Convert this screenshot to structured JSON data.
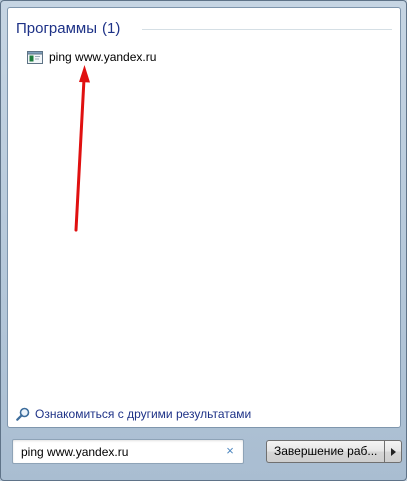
{
  "results_group": {
    "title": "Программы",
    "count": "(1)"
  },
  "results": [
    {
      "label": "ping www.yandex.ru",
      "icon": "command-prompt-icon"
    }
  ],
  "more_results": {
    "label": "Ознакомиться с другими результатами",
    "icon": "search-icon"
  },
  "search": {
    "value": "ping www.yandex.ru",
    "clear_glyph": "×"
  },
  "shutdown": {
    "label": "Завершение раб...",
    "arrow_icon": "triangle-right-icon"
  },
  "colors": {
    "group_header": "#1e3287",
    "annotation_arrow": "#e01010"
  }
}
